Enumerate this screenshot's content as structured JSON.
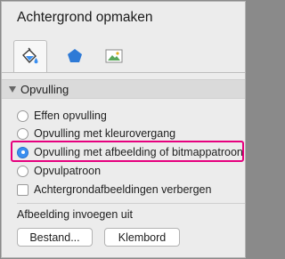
{
  "panel": {
    "title": "Achtergrond opmaken"
  },
  "tabs": [
    {
      "icon": "paint-bucket-icon"
    },
    {
      "icon": "pentagon-icon"
    },
    {
      "icon": "picture-icon"
    }
  ],
  "section": {
    "label": "Opvulling"
  },
  "fill_options": [
    {
      "label": "Effen opvulling",
      "selected": false
    },
    {
      "label": "Opvulling met kleurovergang",
      "selected": false
    },
    {
      "label": "Opvulling met afbeelding of bitmappatroon",
      "selected": true
    },
    {
      "label": "Opvulpatroon",
      "selected": false
    }
  ],
  "hide_background": {
    "label": "Achtergrondafbeeldingen verbergen",
    "checked": false
  },
  "insert": {
    "label": "Afbeelding invoegen uit",
    "file_button": "Bestand...",
    "clipboard_button": "Klembord"
  },
  "colors": {
    "highlight": "#e6007e",
    "selected_radio": "#3b8ff0"
  }
}
